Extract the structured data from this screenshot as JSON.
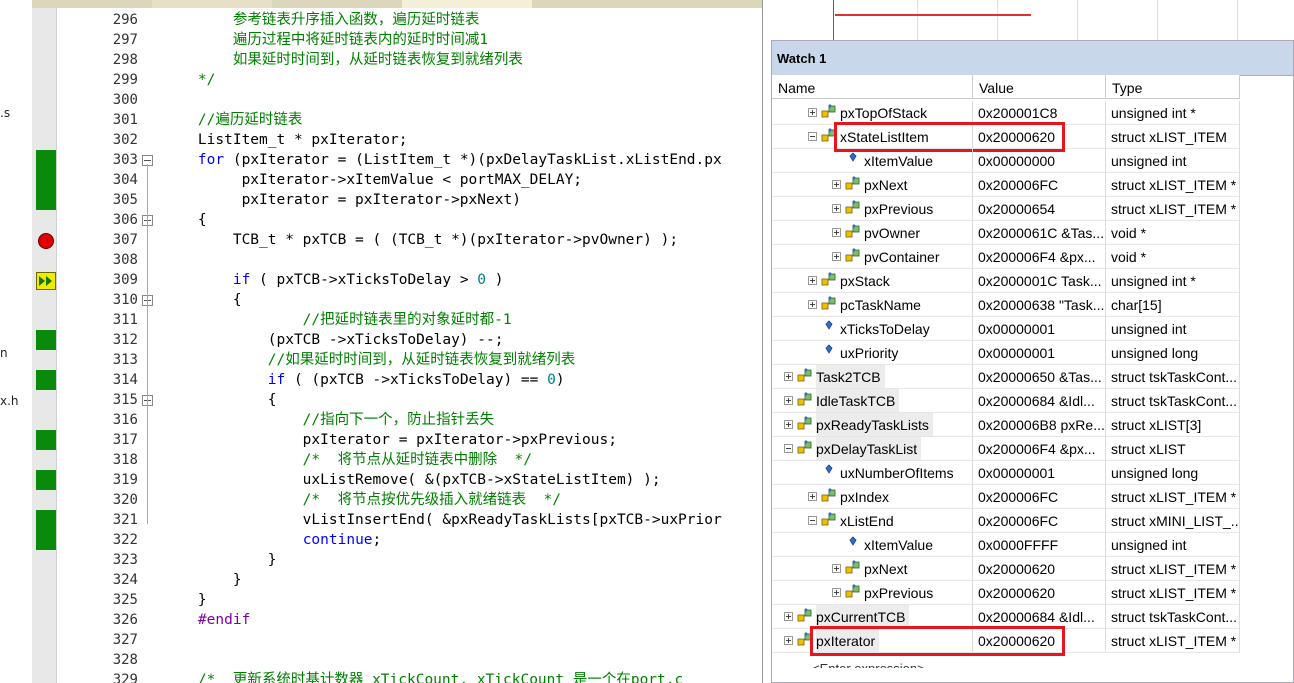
{
  "left_pane": {
    "fragments": [
      ".s",
      "n",
      "x.h"
    ]
  },
  "editor": {
    "lines": [
      {
        "num": "296",
        "parts": [
          {
            "t": "        参考链表升序插入函数，遍历延时链表",
            "c": "cmt"
          }
        ],
        "cov": false
      },
      {
        "num": "297",
        "parts": [
          {
            "t": "        遍历过程中将延时链表内的延时时间减1",
            "c": "cmt"
          }
        ],
        "cov": false
      },
      {
        "num": "298",
        "parts": [
          {
            "t": "        如果延时时间到，从延时链表恢复到就绪列表",
            "c": "cmt"
          }
        ],
        "cov": false
      },
      {
        "num": "299",
        "parts": [
          {
            "t": "    */",
            "c": "cmt"
          }
        ],
        "cov": false
      },
      {
        "num": "300",
        "parts": [],
        "cov": false
      },
      {
        "num": "301",
        "parts": [
          {
            "t": "    //遍历延时链表",
            "c": "cmt"
          }
        ],
        "cov": false
      },
      {
        "num": "302",
        "parts": [
          {
            "t": "    ListItem_t * pxIterator;",
            "c": ""
          }
        ],
        "cov": false
      },
      {
        "num": "303",
        "parts": [
          {
            "t": "    ",
            "c": ""
          },
          {
            "t": "for",
            "c": "kw"
          },
          {
            "t": " (pxIterator = (ListItem_t *)(pxDelayTaskList.xListEnd.px",
            "c": ""
          }
        ],
        "cov": true,
        "fold": true
      },
      {
        "num": "304",
        "parts": [
          {
            "t": "         pxIterator->xItemValue < portMAX_DELAY;",
            "c": ""
          }
        ],
        "cov": true
      },
      {
        "num": "305",
        "parts": [
          {
            "t": "         pxIterator = pxIterator->pxNext)",
            "c": ""
          }
        ],
        "cov": true
      },
      {
        "num": "306",
        "parts": [
          {
            "t": "    {",
            "c": ""
          }
        ],
        "cov": false,
        "fold": true
      },
      {
        "num": "307",
        "parts": [
          {
            "t": "        TCB_t * pxTCB = ( (TCB_t *)(pxIterator->pvOwner) );",
            "c": ""
          }
        ],
        "cov": false,
        "bp": true
      },
      {
        "num": "308",
        "parts": [],
        "cov": false
      },
      {
        "num": "309",
        "parts": [
          {
            "t": "        ",
            "c": ""
          },
          {
            "t": "if",
            "c": "kw"
          },
          {
            "t": " ( pxTCB->xTicksToDelay > ",
            "c": ""
          },
          {
            "t": "0",
            "c": "num"
          },
          {
            "t": " )",
            "c": ""
          }
        ],
        "cov": false,
        "cur": true
      },
      {
        "num": "310",
        "parts": [
          {
            "t": "        {",
            "c": ""
          }
        ],
        "cov": false,
        "fold": true
      },
      {
        "num": "311",
        "parts": [
          {
            "t": "                //把延时链表里的对象延时都-1",
            "c": "cmt"
          }
        ],
        "cov": false
      },
      {
        "num": "312",
        "parts": [
          {
            "t": "            (pxTCB ->xTicksToDelay) --;",
            "c": ""
          }
        ],
        "cov": true
      },
      {
        "num": "313",
        "parts": [
          {
            "t": "            //如果延时时间到，从延时链表恢复到就绪列表",
            "c": "cmt"
          }
        ],
        "cov": false
      },
      {
        "num": "314",
        "parts": [
          {
            "t": "            ",
            "c": ""
          },
          {
            "t": "if",
            "c": "kw"
          },
          {
            "t": " ( (pxTCB ->xTicksToDelay) == ",
            "c": ""
          },
          {
            "t": "0",
            "c": "num"
          },
          {
            "t": ")",
            "c": ""
          }
        ],
        "cov": true
      },
      {
        "num": "315",
        "parts": [
          {
            "t": "            {",
            "c": ""
          }
        ],
        "cov": false,
        "fold": true
      },
      {
        "num": "316",
        "parts": [
          {
            "t": "                //指向下一个，防止指针丢失",
            "c": "cmt"
          }
        ],
        "cov": false
      },
      {
        "num": "317",
        "parts": [
          {
            "t": "                pxIterator = pxIterator->pxPrevious;",
            "c": ""
          }
        ],
        "cov": true
      },
      {
        "num": "318",
        "parts": [
          {
            "t": "                /*  将节点从延时链表中删除  */",
            "c": "cmt"
          }
        ],
        "cov": false
      },
      {
        "num": "319",
        "parts": [
          {
            "t": "                uxListRemove( &(pxTCB->xStateListItem) );",
            "c": ""
          }
        ],
        "cov": true
      },
      {
        "num": "320",
        "parts": [
          {
            "t": "                /*  将节点按优先级插入就绪链表  */",
            "c": "cmt"
          }
        ],
        "cov": false
      },
      {
        "num": "321",
        "parts": [
          {
            "t": "                vListInsertEnd( &pxReadyTaskLists[pxTCB->uxPrior",
            "c": ""
          }
        ],
        "cov": true
      },
      {
        "num": "322",
        "parts": [
          {
            "t": "                ",
            "c": ""
          },
          {
            "t": "continue",
            "c": "kw"
          },
          {
            "t": ";",
            "c": ""
          }
        ],
        "cov": true
      },
      {
        "num": "323",
        "parts": [
          {
            "t": "            }",
            "c": ""
          }
        ],
        "cov": false
      },
      {
        "num": "324",
        "parts": [
          {
            "t": "        }",
            "c": ""
          }
        ],
        "cov": false
      },
      {
        "num": "325",
        "parts": [
          {
            "t": "    }",
            "c": ""
          }
        ],
        "cov": false
      },
      {
        "num": "326",
        "parts": [
          {
            "t": "    ",
            "c": ""
          },
          {
            "t": "#endif",
            "c": "pp"
          }
        ],
        "cov": false
      },
      {
        "num": "327",
        "parts": [],
        "cov": false
      },
      {
        "num": "328",
        "parts": [],
        "cov": false
      },
      {
        "num": "329",
        "parts": [
          {
            "t": "    /*  更新系统时基计数器 xTickCount, xTickCount 是一个在port.c",
            "c": "cmt"
          }
        ],
        "cov": false
      }
    ]
  },
  "watch": {
    "title": "Watch 1",
    "columns": {
      "name": "Name",
      "value": "Value",
      "type": "Type"
    },
    "rows": [
      {
        "name": "pxTopOfStack",
        "value": "0x200001C8",
        "type": "unsigned int *",
        "indent": 1,
        "expander": "plus",
        "icon": "struct-member-icon"
      },
      {
        "name": "xStateListItem",
        "value": "0x20000620",
        "type": "struct xLIST_ITEM",
        "indent": 1,
        "expander": "minus",
        "icon": "struct-member-icon",
        "highlight": true
      },
      {
        "name": "xItemValue",
        "value": "0x00000000",
        "type": "unsigned int",
        "indent": 2,
        "expander": "none",
        "icon": "field-icon"
      },
      {
        "name": "pxNext",
        "value": "0x200006FC",
        "type": "struct xLIST_ITEM *",
        "indent": 2,
        "expander": "plus",
        "icon": "struct-member-icon"
      },
      {
        "name": "pxPrevious",
        "value": "0x20000654",
        "type": "struct xLIST_ITEM *",
        "indent": 2,
        "expander": "plus",
        "icon": "struct-member-icon"
      },
      {
        "name": "pvOwner",
        "value": "0x2000061C &Tas...",
        "type": "void *",
        "indent": 2,
        "expander": "plus",
        "icon": "struct-member-icon"
      },
      {
        "name": "pvContainer",
        "value": "0x200006F4 &px...",
        "type": "void *",
        "indent": 2,
        "expander": "plus",
        "icon": "struct-member-icon"
      },
      {
        "name": "pxStack",
        "value": "0x2000001C Task...",
        "type": "unsigned int *",
        "indent": 1,
        "expander": "plus",
        "icon": "struct-member-icon"
      },
      {
        "name": "pcTaskName",
        "value": "0x20000638 \"Task...",
        "type": "char[15]",
        "indent": 1,
        "expander": "plus",
        "icon": "struct-member-icon"
      },
      {
        "name": "xTicksToDelay",
        "value": "0x00000001",
        "type": "unsigned int",
        "indent": 1,
        "expander": "none",
        "icon": "field-icon"
      },
      {
        "name": "uxPriority",
        "value": "0x00000001",
        "type": "unsigned long",
        "indent": 1,
        "expander": "none",
        "icon": "field-icon"
      },
      {
        "name": "Task2TCB",
        "value": "0x20000650 &Tas...",
        "type": "struct tskTaskCont...",
        "indent": 0,
        "expander": "plus",
        "icon": "struct-member-icon",
        "top": true
      },
      {
        "name": "IdleTaskTCB",
        "value": "0x20000684 &Idl...",
        "type": "struct tskTaskCont...",
        "indent": 0,
        "expander": "plus",
        "icon": "struct-member-icon",
        "top": true
      },
      {
        "name": "pxReadyTaskLists",
        "value": "0x200006B8 pxRe...",
        "type": "struct xLIST[3]",
        "indent": 0,
        "expander": "plus",
        "icon": "struct-member-icon",
        "top": true
      },
      {
        "name": "pxDelayTaskList",
        "value": "0x200006F4 &px...",
        "type": "struct xLIST",
        "indent": 0,
        "expander": "minus",
        "icon": "struct-member-icon",
        "top": true
      },
      {
        "name": "uxNumberOfItems",
        "value": "0x00000001",
        "type": "unsigned long",
        "indent": 1,
        "expander": "none",
        "icon": "field-icon"
      },
      {
        "name": "pxIndex",
        "value": "0x200006FC",
        "type": "struct xLIST_ITEM *",
        "indent": 1,
        "expander": "plus",
        "icon": "struct-member-icon"
      },
      {
        "name": "xListEnd",
        "value": "0x200006FC",
        "type": "struct xMINI_LIST_...",
        "indent": 1,
        "expander": "minus",
        "icon": "struct-member-icon"
      },
      {
        "name": "xItemValue",
        "value": "0x0000FFFF",
        "type": "unsigned int",
        "indent": 2,
        "expander": "none",
        "icon": "field-icon"
      },
      {
        "name": "pxNext",
        "value": "0x20000620",
        "type": "struct xLIST_ITEM *",
        "indent": 2,
        "expander": "plus",
        "icon": "struct-member-icon"
      },
      {
        "name": "pxPrevious",
        "value": "0x20000620",
        "type": "struct xLIST_ITEM *",
        "indent": 2,
        "expander": "plus",
        "icon": "struct-member-icon"
      },
      {
        "name": "pxCurrentTCB",
        "value": "0x20000684 &Idl...",
        "type": "struct tskTaskCont...",
        "indent": 0,
        "expander": "plus",
        "icon": "struct-member-icon",
        "top": true
      },
      {
        "name": "pxIterator",
        "value": "0x20000620",
        "type": "struct xLIST_ITEM *",
        "indent": 0,
        "expander": "plus",
        "icon": "struct-member-icon",
        "top": true,
        "highlight": true
      }
    ],
    "footer_hint": "<Enter expression>"
  },
  "colors": {
    "coverage": "#0a8a0a",
    "breakpoint": "#e00000",
    "highlight": "#e8141e",
    "watch_title": "#c8d7ea",
    "comment": "#008000",
    "keyword": "#0000ff"
  }
}
